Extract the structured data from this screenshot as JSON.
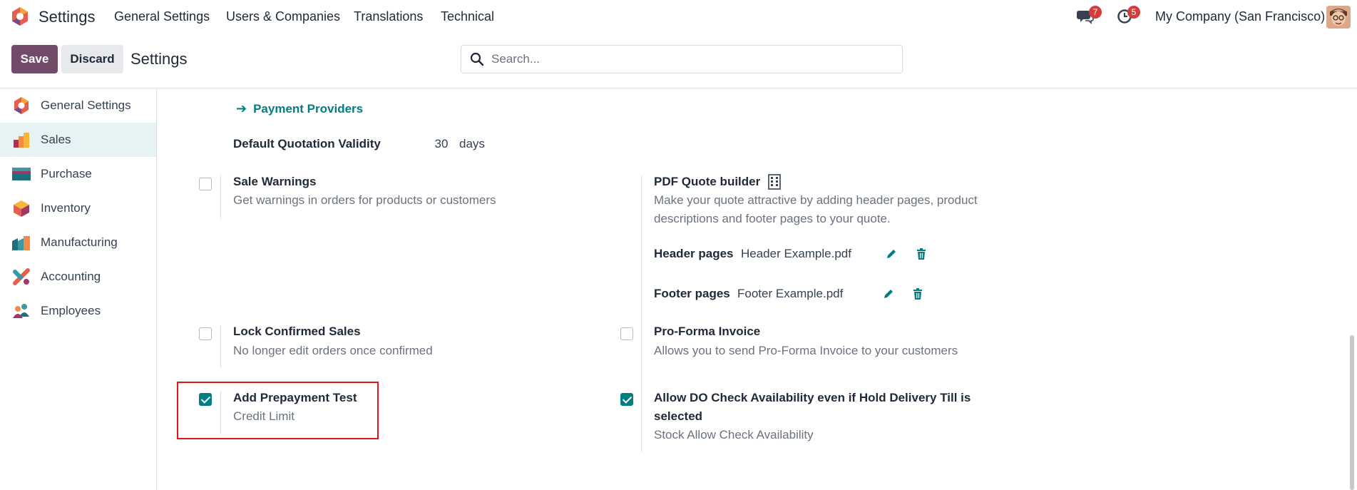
{
  "navbar": {
    "app_name": "Settings",
    "menu": [
      "General Settings",
      "Users & Companies",
      "Translations",
      "Technical"
    ],
    "chat_badge": "7",
    "activity_badge": "5",
    "company": "My Company (San Francisco)"
  },
  "control_panel": {
    "save_label": "Save",
    "discard_label": "Discard",
    "title": "Settings",
    "search_placeholder": "Search..."
  },
  "sidebar": {
    "items": [
      {
        "label": "General Settings",
        "icon": "general-settings-icon",
        "active": false
      },
      {
        "label": "Sales",
        "icon": "sales-icon",
        "active": true
      },
      {
        "label": "Purchase",
        "icon": "purchase-icon",
        "active": false
      },
      {
        "label": "Inventory",
        "icon": "inventory-icon",
        "active": false
      },
      {
        "label": "Manufacturing",
        "icon": "manufacturing-icon",
        "active": false
      },
      {
        "label": "Accounting",
        "icon": "accounting-icon",
        "active": false
      },
      {
        "label": "Employees",
        "icon": "employees-icon",
        "active": false
      }
    ]
  },
  "content": {
    "payment_providers_link": "Payment Providers",
    "quotation_validity": {
      "label": "Default Quotation Validity",
      "value": "30",
      "unit": "days"
    },
    "sale_warnings": {
      "title": "Sale Warnings",
      "desc": "Get warnings in orders for products or customers",
      "checked": false
    },
    "pdf_quote_builder": {
      "title": "PDF Quote builder",
      "desc_line1": "Make your quote attractive by adding header pages, product",
      "desc_line2": "descriptions and footer pages to your quote.",
      "header_label": "Header pages",
      "header_file": "Header Example.pdf",
      "footer_label": "Footer pages",
      "footer_file": "Footer Example.pdf"
    },
    "lock_confirmed_sales": {
      "title": "Lock Confirmed Sales",
      "desc": "No longer edit orders once confirmed",
      "checked": false
    },
    "pro_forma_invoice": {
      "title": "Pro-Forma Invoice",
      "desc": "Allows you to send Pro-Forma Invoice to your customers",
      "checked": false
    },
    "add_prepayment_test": {
      "title": "Add Prepayment Test",
      "desc": "Credit Limit",
      "checked": true
    },
    "allow_do_check": {
      "title_line1": "Allow DO Check Availability even if Hold Delivery Till is",
      "title_line2": "selected",
      "desc": "Stock Allow Check Availability",
      "checked": true
    }
  },
  "colors": {
    "brand": "#714b67",
    "accent": "#017e84",
    "highlight": "#e0161f",
    "badge": "#d23f3a"
  }
}
